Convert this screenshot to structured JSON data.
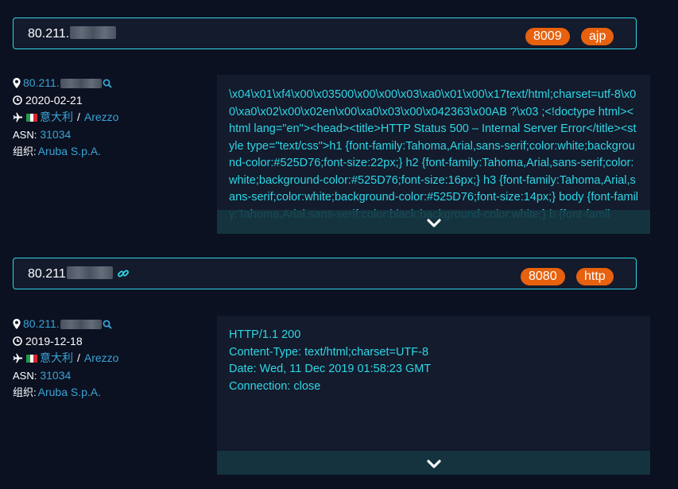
{
  "results": [
    {
      "ip_prefix": "80.211.",
      "ports": [
        "8009",
        "ajp"
      ],
      "ip_short": "80.211.",
      "date": "2020-02-21",
      "country": "意大利",
      "city": "Arezzo",
      "asn_label": "ASN:",
      "asn": "31034",
      "org_label": "组织:",
      "org": "Aruba S.p.A.",
      "banner": "\\x04\\x01\\xf4\\x00\\x03500\\x00\\x00\\x03\\xa0\\x01\\x00\\x17text/html;charset=utf-8\\x00\\xa0\\x02\\x00\\x02en\\x00\\xa0\\x03\\x00\\x042363\\x00AB ?\\x03 ;<!doctype html><html lang=\"en\"><head><title>HTTP Status 500 – Internal Server Error</title><style type=\"text/css\">h1 {font-family:Tahoma,Arial,sans-serif;color:white;background-color:#525D76;font-size:22px;} h2 {font-family:Tahoma,Arial,sans-serif;color:white;background-color:#525D76;font-size:16px;} h3 {font-family:Tahoma,Arial,sans-serif;color:white;background-color:#525D76;font-size:14px;} body {font-family:Tahoma,Arial,sans-serif;color:black;background-color:white;} b {font-famil"
    },
    {
      "ip_prefix": "80.211",
      "ports": [
        "8080",
        "http"
      ],
      "ip_short": "80.211.",
      "date": "2019-12-18",
      "country": "意大利",
      "city": "Arezzo",
      "asn_label": "ASN:",
      "asn": "31034",
      "org_label": "组织:",
      "org": "Aruba S.p.A.",
      "banner": "HTTP/1.1 200\nContent-Type: text/html;charset=UTF-8\nDate: Wed, 11 Dec 2019 01:58:23 GMT\nConnection: close"
    }
  ],
  "colors": {
    "accent": "#2fd6e6",
    "link": "#3aa3d6",
    "badge": "#e8610e",
    "background": "#0b1120",
    "panel": "#131b2c"
  },
  "icons": [
    "map-marker-icon",
    "search-icon",
    "clock-icon",
    "plane-icon",
    "italy-flag-icon",
    "link-icon",
    "chevron-down-icon"
  ]
}
